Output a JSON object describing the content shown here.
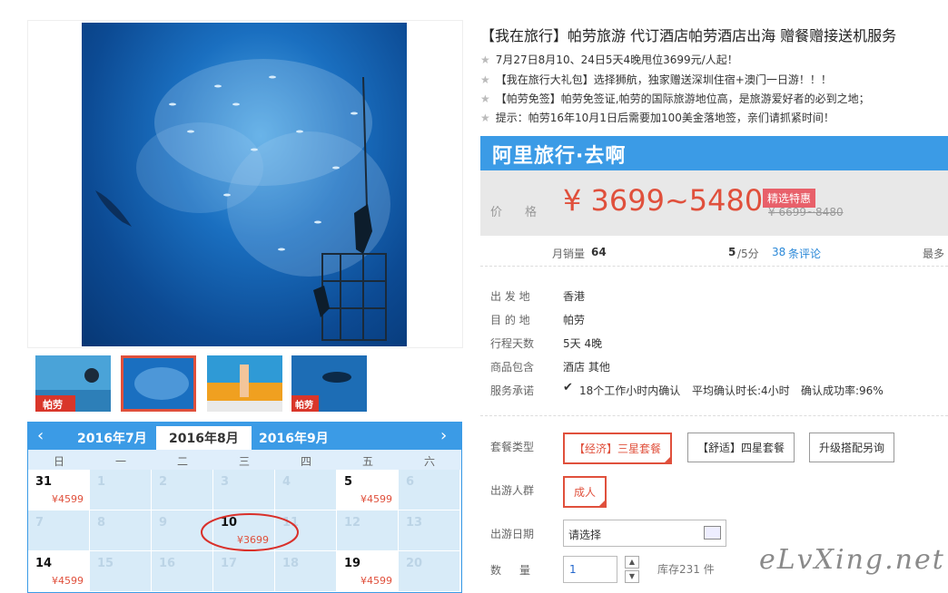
{
  "product": {
    "title": "【我在旅行】帕劳旅游 代订酒店帕劳酒店出海 赠餐赠接送机服务",
    "bullets": [
      "7月27日8月10、24日5天4晚甩位3699元/人起！",
      "【我在旅行大礼包】选择狮航，独家赠送深圳住宿+澳门一日游！！！",
      "【帕劳免签】帕劳免签证,帕劳的国际旅游地位高，是旅游爱好者的必到之地；",
      "提示：帕劳16年10月1日后需要加100美金落地签，亲们请抓紧时间！"
    ]
  },
  "banner": {
    "text": "阿里旅行·去啊"
  },
  "price": {
    "label": "价　格",
    "range": "¥ 3699~5480",
    "promo": "精选特惠",
    "original": "¥ 6699~8480"
  },
  "stats": {
    "monthly_label": "月销量",
    "monthly_value": "64",
    "rating": "5",
    "rating_suffix": "/5分",
    "reviews_count": "38",
    "reviews_label": "条评论",
    "more": "最多"
  },
  "info": [
    {
      "label": "出 发 地",
      "value": "香港"
    },
    {
      "label": "目 的 地",
      "value": "帕劳"
    },
    {
      "label": "行程天数",
      "value": "5天 4晚"
    },
    {
      "label": "商品包含",
      "value": "酒店  其他"
    }
  ],
  "service": {
    "label": "服务承诺",
    "items": [
      "18个工作小时内确认",
      "平均确认时长:4小时",
      "确认成功率:96%"
    ]
  },
  "options": {
    "package_label": "套餐类型",
    "packages": [
      "【经济】三星套餐",
      "【舒适】四星套餐",
      "升级搭配另询"
    ],
    "crowd_label": "出游人群",
    "crowd": "成人",
    "date_label": "出游日期",
    "date_value": "请选择",
    "qty_label": "数　量",
    "qty_value": "1",
    "stock": "库存231 件"
  },
  "calendar": {
    "months": [
      "2016年7月",
      "2016年8月",
      "2016年9月"
    ],
    "active_month": "2016年8月",
    "weekdays": [
      "日",
      "一",
      "二",
      "三",
      "四",
      "五",
      "六"
    ],
    "rows": [
      [
        {
          "d": "31",
          "p": "¥4599",
          "s": "on"
        },
        {
          "d": "1"
        },
        {
          "d": "2"
        },
        {
          "d": "3"
        },
        {
          "d": "4"
        },
        {
          "d": "5",
          "p": "¥4599",
          "s": "on"
        },
        {
          "d": "6"
        }
      ],
      [
        {
          "d": "7"
        },
        {
          "d": "8"
        },
        {
          "d": "9"
        },
        {
          "d": "10",
          "p": "¥3699",
          "s": "b"
        },
        {
          "d": "11"
        },
        {
          "d": "12"
        },
        {
          "d": "13"
        }
      ],
      [
        {
          "d": "14",
          "p": "¥4599",
          "s": "on"
        },
        {
          "d": "15"
        },
        {
          "d": "16"
        },
        {
          "d": "17"
        },
        {
          "d": "18"
        },
        {
          "d": "19",
          "p": "¥4599",
          "s": "on"
        },
        {
          "d": "20"
        }
      ]
    ]
  },
  "watermark": "eLvXing.net",
  "colors": {
    "accent": "#e0503c",
    "blue": "#3b9be6"
  }
}
